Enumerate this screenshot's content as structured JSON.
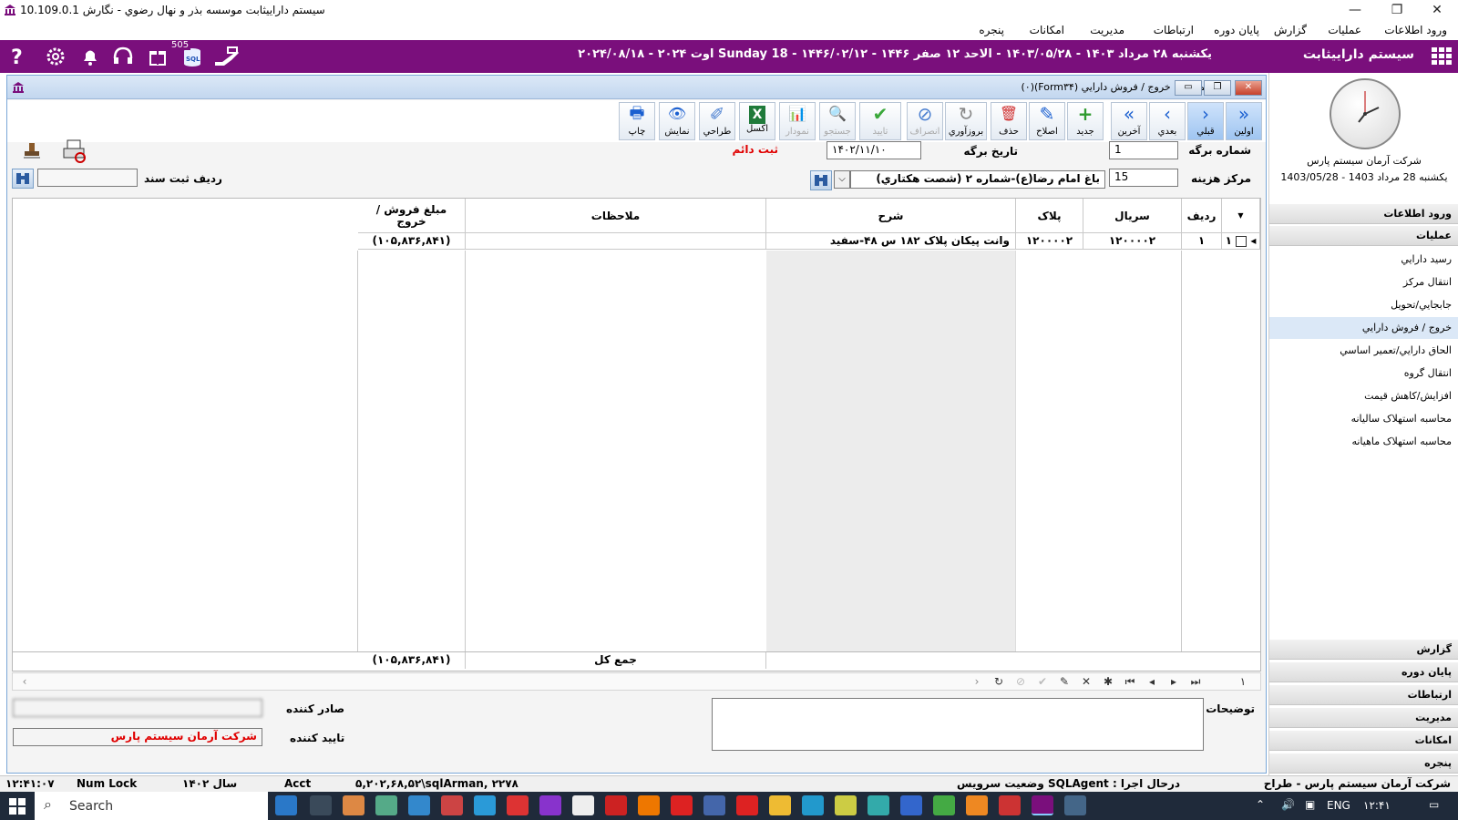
{
  "app_title": "سیستم داراییثابت موسسه بذر و نهال رضوي - نگارش 10.109.0.1",
  "menu": [
    "ورود اطلاعات",
    "عمليات",
    "گزارش",
    "پايان دوره",
    "ارتباطات",
    "مديريت",
    "امکانات",
    "پنجره"
  ],
  "header": {
    "date_text": "يكشنبه ۲۸ مرداد ۱۴۰۳ - ۱۴۰۳/۰۵/۲۸ - الاحد ۱۲ صفر ۱۴۴۶ - ۱۴۴۶/۰۲/۱۲ - Sunday 18 اوت ۲۰۲۴ - ۲۰۲۴/۰۸/۱۸",
    "system_name": "سیستم داراییثابت",
    "sql_badge": "505",
    "sql_label": "SQL"
  },
  "sidebar": {
    "company": "شرکت آرمان سیستم پارس",
    "date": "يكشنبه 28 مرداد 1403 - 1403/05/28",
    "sections_top": [
      "ورود اطلاعات",
      "عملیات"
    ],
    "items": [
      "رسيد دارايي",
      "انتقال مركز",
      "جابجايي/تحويل",
      "خروج / فروش دارايي",
      "الحاق دارايي/تعمير اساسي",
      "انتقال گروه",
      "افزايش/کاهش قيمت",
      "محاسبه استهلاک ساليانه",
      "محاسبه استهلاک ماهيانه"
    ],
    "selected_item": 3,
    "sections_bottom": [
      "گزارش",
      "پایان دوره",
      "ارتباطات",
      "مدیریت",
      "امکانات",
      "پنجره"
    ]
  },
  "form": {
    "title": "عمليات : خروج / فروش دارايي (Form۳۴)(۰)",
    "toolbar": [
      {
        "label": "اولين",
        "glyph": "»"
      },
      {
        "label": "قبلي",
        "glyph": "›"
      },
      {
        "label": "بعدي",
        "glyph": "‹"
      },
      {
        "label": "آخرين",
        "glyph": "«"
      },
      {
        "label": "جديد",
        "glyph": "+"
      },
      {
        "label": "اصلاح",
        "glyph": "✎"
      },
      {
        "label": "حذف",
        "glyph": "🗑"
      },
      {
        "label": "بروزآوري",
        "glyph": "↻"
      },
      {
        "label": "انصراف",
        "glyph": "⊘"
      },
      {
        "label": "تاييد",
        "glyph": "✔"
      },
      {
        "label": "جستجو",
        "glyph": "🔍"
      },
      {
        "label": "نمودار",
        "glyph": "📊"
      },
      {
        "label": "اکسل",
        "glyph": "X"
      },
      {
        "label": "طراحي",
        "glyph": "✐"
      },
      {
        "label": "نمايش",
        "glyph": "👁"
      },
      {
        "label": "چاپ",
        "glyph": "🖶"
      }
    ],
    "sheet_number_label": "شماره برگه",
    "sheet_number": "1",
    "sheet_date_label": "تاريخ برگه",
    "sheet_date": "۱۴۰۲/۱۱/۱۰",
    "status_label": "ثبت دائم",
    "cost_center_label": "مرکز هزينه",
    "cost_center_code": "15",
    "cost_center_name": "باغ امام رضا(ع)-شماره ۲ (شصت هکتاري)",
    "doc_row_label": "رديف ثبت سند",
    "doc_row_value": ""
  },
  "grid": {
    "columns": [
      "رديف",
      "سريال",
      "پلاک",
      "شرح",
      "ملاحظات",
      "مبلغ فروش /خروج"
    ],
    "rows": [
      {
        "row_num": "۱",
        "radif": "۱",
        "serial": "۱۲۰۰۰۰۲",
        "plaque": "۱۲۰۰۰۰۲",
        "desc": "وانت پيکان پلاک ۱۸۲ س ۴۸-سفيد",
        "notes": "",
        "amount": "(۱۰۵,۸۳۶,۸۴۱)"
      }
    ],
    "total_label": "جمع کل",
    "total_amount": "(۱۰۵,۸۳۶,۸۴۱)",
    "record_index": "۱"
  },
  "bottom": {
    "notes_label": "توضيحات",
    "issuer_label": "صادر کننده",
    "issuer_value": "",
    "approver_label": "تاييد کننده",
    "approver_value": "شرکت آرمان سیستم پارس"
  },
  "status": {
    "time": "۱۲:۴۱:۰۷",
    "numlock": "Num Lock",
    "year": "سال ۱۴۰۲",
    "acct": "Acct",
    "conn": "۵,۲۰۲,۶۸,۵۲\\sqlArman, ۲۲۷۸",
    "service": "درحال اجرا : SQLAgent وضعيت سرويس",
    "company": "شرکت آرمان سيستم پارس - طراح"
  },
  "taskbar": {
    "search": "Search",
    "lang": "ENG",
    "time": "۱۲:۴۱"
  },
  "colors": {
    "brand_purple": "#7a0f7c",
    "accent_red": "#e00000"
  }
}
